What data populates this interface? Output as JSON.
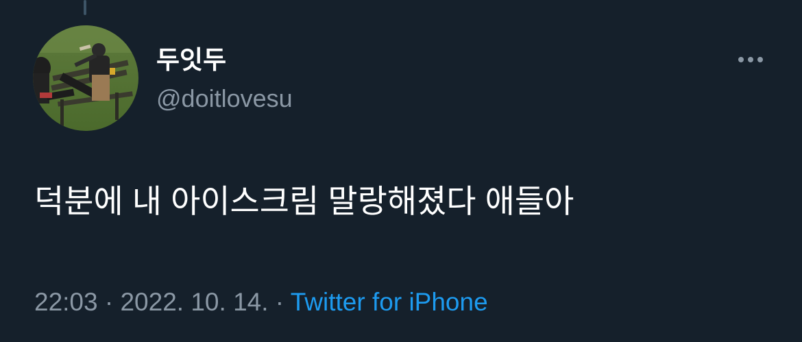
{
  "tweet": {
    "display_name": "두잇두",
    "handle": "@doitlovesu",
    "avatar_icon": "user-avatar-photo",
    "more_icon": "more-horizontal-icon",
    "text": "덕분에 내 아이스크림 말랑해졌다 애들아",
    "time": "22:03",
    "separator": "·",
    "date": "2022. 10. 14.",
    "source": "Twitter for iPhone"
  },
  "colors": {
    "background": "#15202b",
    "primary_text": "#ffffff",
    "secondary_text": "#8b98a5",
    "link": "#1d9bf0"
  }
}
